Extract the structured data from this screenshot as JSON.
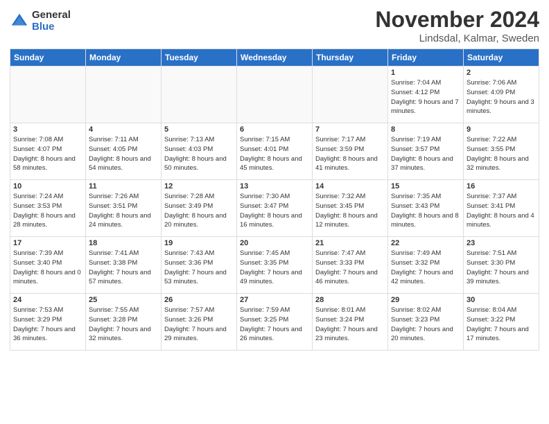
{
  "logo": {
    "general": "General",
    "blue": "Blue"
  },
  "title": "November 2024",
  "location": "Lindsdal, Kalmar, Sweden",
  "weekdays": [
    "Sunday",
    "Monday",
    "Tuesday",
    "Wednesday",
    "Thursday",
    "Friday",
    "Saturday"
  ],
  "weeks": [
    [
      {
        "day": "",
        "info": ""
      },
      {
        "day": "",
        "info": ""
      },
      {
        "day": "",
        "info": ""
      },
      {
        "day": "",
        "info": ""
      },
      {
        "day": "",
        "info": ""
      },
      {
        "day": "1",
        "info": "Sunrise: 7:04 AM\nSunset: 4:12 PM\nDaylight: 9 hours\nand 7 minutes."
      },
      {
        "day": "2",
        "info": "Sunrise: 7:06 AM\nSunset: 4:09 PM\nDaylight: 9 hours\nand 3 minutes."
      }
    ],
    [
      {
        "day": "3",
        "info": "Sunrise: 7:08 AM\nSunset: 4:07 PM\nDaylight: 8 hours\nand 58 minutes."
      },
      {
        "day": "4",
        "info": "Sunrise: 7:11 AM\nSunset: 4:05 PM\nDaylight: 8 hours\nand 54 minutes."
      },
      {
        "day": "5",
        "info": "Sunrise: 7:13 AM\nSunset: 4:03 PM\nDaylight: 8 hours\nand 50 minutes."
      },
      {
        "day": "6",
        "info": "Sunrise: 7:15 AM\nSunset: 4:01 PM\nDaylight: 8 hours\nand 45 minutes."
      },
      {
        "day": "7",
        "info": "Sunrise: 7:17 AM\nSunset: 3:59 PM\nDaylight: 8 hours\nand 41 minutes."
      },
      {
        "day": "8",
        "info": "Sunrise: 7:19 AM\nSunset: 3:57 PM\nDaylight: 8 hours\nand 37 minutes."
      },
      {
        "day": "9",
        "info": "Sunrise: 7:22 AM\nSunset: 3:55 PM\nDaylight: 8 hours\nand 32 minutes."
      }
    ],
    [
      {
        "day": "10",
        "info": "Sunrise: 7:24 AM\nSunset: 3:53 PM\nDaylight: 8 hours\nand 28 minutes."
      },
      {
        "day": "11",
        "info": "Sunrise: 7:26 AM\nSunset: 3:51 PM\nDaylight: 8 hours\nand 24 minutes."
      },
      {
        "day": "12",
        "info": "Sunrise: 7:28 AM\nSunset: 3:49 PM\nDaylight: 8 hours\nand 20 minutes."
      },
      {
        "day": "13",
        "info": "Sunrise: 7:30 AM\nSunset: 3:47 PM\nDaylight: 8 hours\nand 16 minutes."
      },
      {
        "day": "14",
        "info": "Sunrise: 7:32 AM\nSunset: 3:45 PM\nDaylight: 8 hours\nand 12 minutes."
      },
      {
        "day": "15",
        "info": "Sunrise: 7:35 AM\nSunset: 3:43 PM\nDaylight: 8 hours\nand 8 minutes."
      },
      {
        "day": "16",
        "info": "Sunrise: 7:37 AM\nSunset: 3:41 PM\nDaylight: 8 hours\nand 4 minutes."
      }
    ],
    [
      {
        "day": "17",
        "info": "Sunrise: 7:39 AM\nSunset: 3:40 PM\nDaylight: 8 hours\nand 0 minutes."
      },
      {
        "day": "18",
        "info": "Sunrise: 7:41 AM\nSunset: 3:38 PM\nDaylight: 7 hours\nand 57 minutes."
      },
      {
        "day": "19",
        "info": "Sunrise: 7:43 AM\nSunset: 3:36 PM\nDaylight: 7 hours\nand 53 minutes."
      },
      {
        "day": "20",
        "info": "Sunrise: 7:45 AM\nSunset: 3:35 PM\nDaylight: 7 hours\nand 49 minutes."
      },
      {
        "day": "21",
        "info": "Sunrise: 7:47 AM\nSunset: 3:33 PM\nDaylight: 7 hours\nand 46 minutes."
      },
      {
        "day": "22",
        "info": "Sunrise: 7:49 AM\nSunset: 3:32 PM\nDaylight: 7 hours\nand 42 minutes."
      },
      {
        "day": "23",
        "info": "Sunrise: 7:51 AM\nSunset: 3:30 PM\nDaylight: 7 hours\nand 39 minutes."
      }
    ],
    [
      {
        "day": "24",
        "info": "Sunrise: 7:53 AM\nSunset: 3:29 PM\nDaylight: 7 hours\nand 36 minutes."
      },
      {
        "day": "25",
        "info": "Sunrise: 7:55 AM\nSunset: 3:28 PM\nDaylight: 7 hours\nand 32 minutes."
      },
      {
        "day": "26",
        "info": "Sunrise: 7:57 AM\nSunset: 3:26 PM\nDaylight: 7 hours\nand 29 minutes."
      },
      {
        "day": "27",
        "info": "Sunrise: 7:59 AM\nSunset: 3:25 PM\nDaylight: 7 hours\nand 26 minutes."
      },
      {
        "day": "28",
        "info": "Sunrise: 8:01 AM\nSunset: 3:24 PM\nDaylight: 7 hours\nand 23 minutes."
      },
      {
        "day": "29",
        "info": "Sunrise: 8:02 AM\nSunset: 3:23 PM\nDaylight: 7 hours\nand 20 minutes."
      },
      {
        "day": "30",
        "info": "Sunrise: 8:04 AM\nSunset: 3:22 PM\nDaylight: 7 hours\nand 17 minutes."
      }
    ]
  ]
}
